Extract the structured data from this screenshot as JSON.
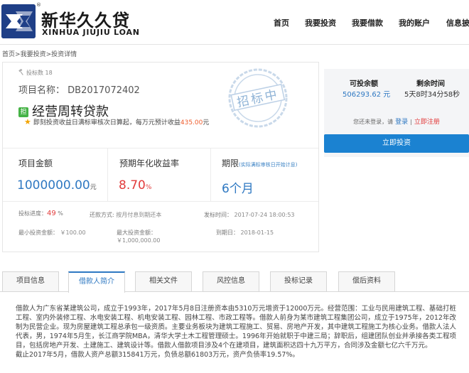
{
  "header": {
    "logo_cn": "新华久久贷",
    "logo_en": "XINHUA JIUJIU LOAN",
    "logo_reg": "®",
    "nav": [
      "首页",
      "我要投资",
      "我要借款",
      "我的账户",
      "信息披"
    ]
  },
  "breadcrumb": [
    "首页",
    ">",
    "我要投资",
    ">",
    "投资详情"
  ],
  "project": {
    "bid_count_label": "投标数",
    "bid_count": "18",
    "project_name_label": "项目名称：",
    "project_code": "DB2017072402",
    "badge": "担",
    "product_name": "经营周转贷款",
    "interest_note_pre": "即刻投资收益日满标审核次日算起，每万元预计收益",
    "interest_note_value": "435.00",
    "interest_note_unit": "元",
    "stamp_text": "招标中"
  },
  "metrics": {
    "amount_label": "项目金额",
    "amount_value": "1000000.00",
    "amount_unit": "元",
    "rate_label": "预期年化收益率",
    "rate_value": "8.70",
    "rate_unit": "%",
    "term_label": "期限",
    "term_note": "(实际满标审核日开始计息)",
    "term_value": "6个月"
  },
  "details": {
    "progress_label": "投标进度：",
    "progress_value": "49",
    "progress_unit": "%",
    "repay_label": "还款方式:",
    "repay_value": "按月付息到期还本",
    "publish_label": "发标时间：",
    "publish_value": "2017-07-24 18:00:53",
    "min_label": "最小投资金额：",
    "min_value": "￥100.00",
    "max_label": "最大投资金额：",
    "max_value": "￥1,000,000.00",
    "due_label": "到期日：",
    "due_value": "2018-01-15"
  },
  "side": {
    "available_label": "可投余额",
    "available_value": "506293.62 元",
    "remaining_label": "剩余时间",
    "remaining_value": "5天8时34分58秒",
    "not_logged_in": "您还未登录，请",
    "login": "登录",
    "register": "立即注册",
    "invest_button": "立即投资"
  },
  "tabs": [
    "项目信息",
    "借款人简介",
    "相关文件",
    "风控信息",
    "投标记录",
    "偿后资料"
  ],
  "active_tab": 1,
  "content": {
    "paragraph1": "借款人为广东省某建筑公司，成立于1993年，2017年5月8日注册资本由5310万元增资于12000万元。经营范围：工业与民用建筑工程、基础打桩工程、室内外装修工程、水电安装工程、机电安装工程、园林工程、市政工程等。借款人前身为某市建筑工程集团公司，成立于1975年，2012年改制为民营企业。现为房屋建筑工程总承包一级资质。主要业务板块为建筑工程施工、贸易、房地产开发，其中建筑工程施工为核心业务。借款人法人代表，男，1974年5月生，长江商学院MBA，清华大学土木工程管理硕士。1996年开始就职于中建三局；辞职后，组建团队创业并承接各类工程项目，包括房地产开发、土建施工、建筑设计等。借款人借款项目涉及4个在建项目，建筑面积达四十九万平方，合同涉及金额七亿六千万元。",
    "paragraph2": "截止2017年5月，借款人资产总额315841万元，负债总额61803万元，资产负债率19.57%。"
  },
  "colors": {
    "brand_blue": "#1f3f87",
    "accent_blue": "#2e78c2",
    "button_blue": "#1b82d1",
    "red": "#e23b3b",
    "badge_green": "#46b346"
  }
}
